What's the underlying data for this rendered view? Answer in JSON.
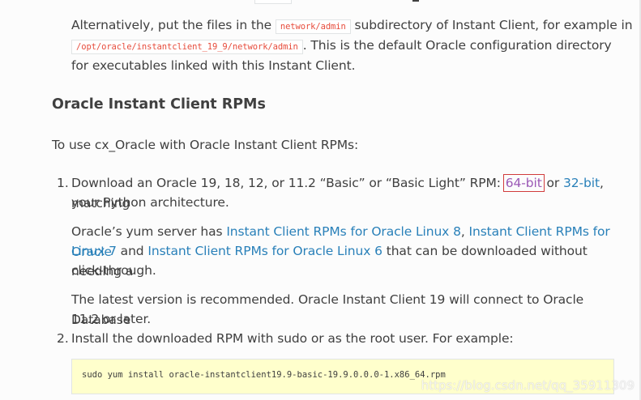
{
  "intro": {
    "text_before": "Alternatively, put the files in the ",
    "code1": "network/admin",
    "text_mid": " subdirectory of Instant Client, for example in",
    "code2": "/opt/oracle/instantclient_19_9/network/admin",
    "text_after": ". This is the default Oracle configuration directory",
    "line3": "for executables linked with this Instant Client."
  },
  "heading": "Oracle Instant Client RPMs",
  "lead": "To use cx_Oracle with Oracle Instant Client RPMs:",
  "steps": [
    {
      "number": "1.",
      "line1_text": "Download an Oracle 19, 18, 12, or 11.2 “Basic” or “Basic Light” RPM: ",
      "link_64": "64-bit",
      "or": " or ",
      "link_32": "32-bit",
      "tail": ", matching",
      "line2": "your Python architecture.",
      "yum": {
        "prefix": "Oracle’s yum server has ",
        "link_ol8": "Instant Client RPMs for Oracle Linux 8",
        "sep": ", ",
        "link_ol7_a": "Instant Client RPMs for Oracle",
        "link_ol7_b": "Linux 7",
        "and": " and ",
        "link_ol6": "Instant Client RPMs for Oracle Linux 6",
        "suffix": " that can be downloaded without needing a",
        "line3": "click-through."
      },
      "latest_line1": "The latest version is recommended. Oracle Instant Client 19 will connect to Oracle Database",
      "latest_line2": "11.2 or later."
    },
    {
      "number": "2.",
      "text": "Install the downloaded RPM with sudo or as the root user. For example:",
      "code": "sudo yum install oracle-instantclient19.9-basic-19.9.0.0.0-1.x86_64.rpm"
    }
  ],
  "watermark": "https://blog.csdn.net/qq_35911309"
}
